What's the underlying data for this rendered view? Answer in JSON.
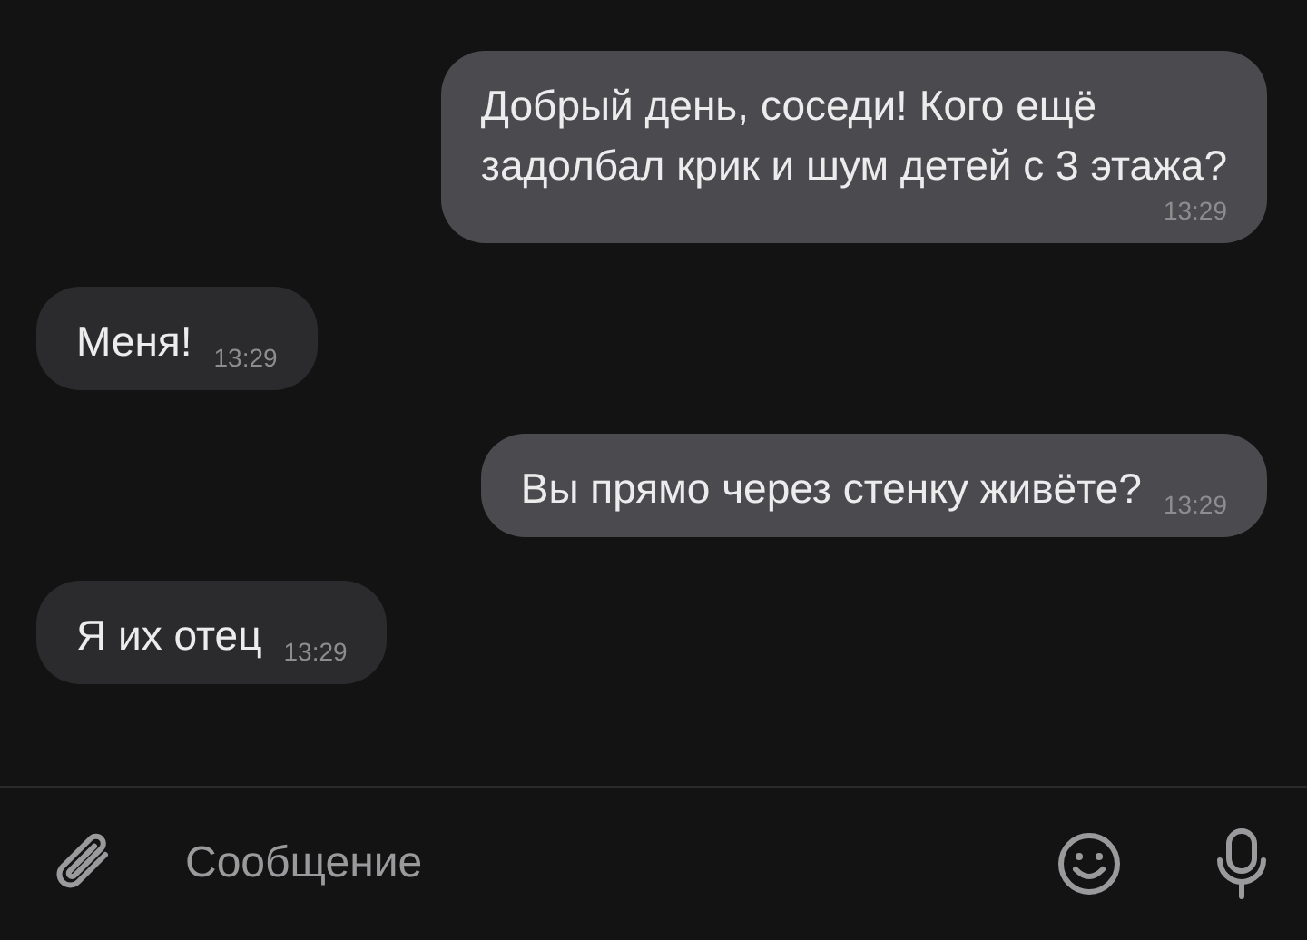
{
  "messages": [
    {
      "kind": "outgoing",
      "lines": [
        "Добрый день, соседи! Кого ещё",
        "задолбал крик и шум детей с 3 этажа?"
      ],
      "time": "13:29"
    },
    {
      "kind": "incoming",
      "lines": [
        "Меня!"
      ],
      "time": "13:29"
    },
    {
      "kind": "outgoing",
      "lines": [
        "Вы прямо через стенку живёте?"
      ],
      "time": "13:29"
    },
    {
      "kind": "incoming",
      "lines": [
        "Я их отец"
      ],
      "time": "13:29"
    }
  ],
  "composer": {
    "placeholder": "Сообщение"
  }
}
